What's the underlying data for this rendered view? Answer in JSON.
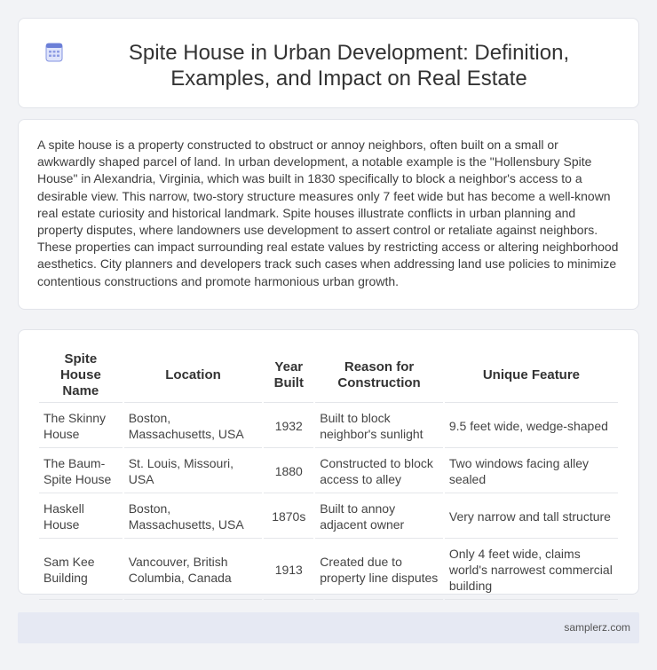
{
  "header": {
    "icon": "document-grid-icon",
    "title": "Spite House in Urban Development: Definition, Examples, and Impact on Real Estate"
  },
  "intro": {
    "paragraph": "A spite house is a property constructed to obstruct or annoy neighbors, often built on a small or awkwardly shaped parcel of land. In urban development, a notable example is the \"Hollensbury Spite House\" in Alexandria, Virginia, which was built in 1830 specifically to block a neighbor's access to a desirable view. This narrow, two-story structure measures only 7 feet wide but has become a well-known real estate curiosity and historical landmark. Spite houses illustrate conflicts in urban planning and property disputes, where landowners use development to assert control or retaliate against neighbors. These properties can impact surrounding real estate values by restricting access or altering neighborhood aesthetics. City planners and developers track such cases when addressing land use policies to minimize contentious constructions and promote harmonious urban growth."
  },
  "table": {
    "headers": [
      "Spite House Name",
      "Location",
      "Year Built",
      "Reason for Construction",
      "Unique Feature"
    ],
    "rows": [
      [
        "The Skinny House",
        "Boston, Massachusetts, USA",
        "1932",
        "Built to block neighbor's sunlight",
        "9.5 feet wide, wedge-shaped"
      ],
      [
        "The Baum-Spite House",
        "St. Louis, Missouri, USA",
        "1880",
        "Constructed to block access to alley",
        "Two windows facing alley sealed"
      ],
      [
        "Haskell House",
        "Boston, Massachusetts, USA",
        "1870s",
        "Built to annoy adjacent owner",
        "Very narrow and tall structure"
      ],
      [
        "Sam Kee Building",
        "Vancouver, British Columbia, Canada",
        "1913",
        "Created due to property line disputes",
        "Only 4 feet wide, claims world's narrowest commercial building"
      ]
    ]
  },
  "footer": {
    "site": "samplerz.com"
  },
  "colors": {
    "page_bg": "#f2f3f6",
    "card_bg": "#ffffff",
    "footer_bg": "#e6e9f3",
    "icon_accent": "#6b7fd7"
  }
}
